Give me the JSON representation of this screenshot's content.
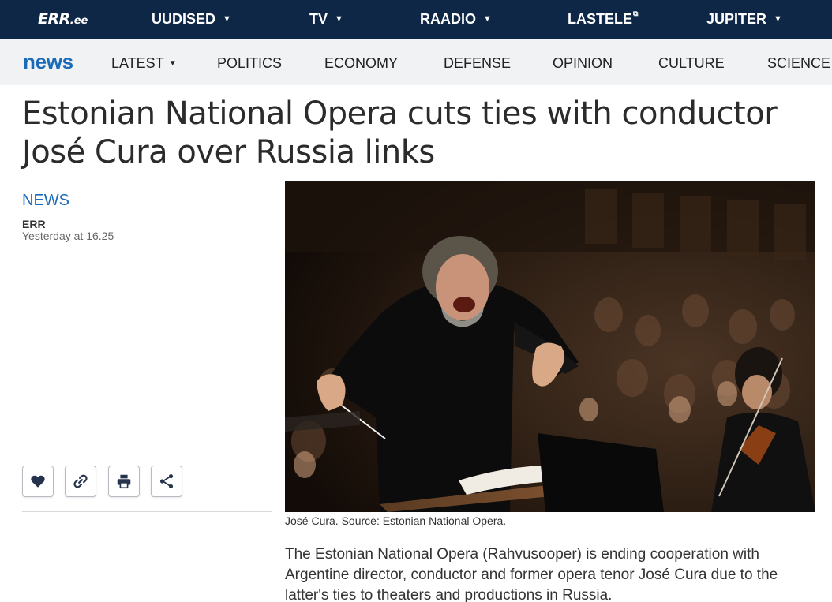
{
  "topbar": {
    "logo_main": "ERR",
    "logo_suffix": ".ee",
    "items": [
      {
        "label": "UUDISED",
        "has_dropdown": true
      },
      {
        "label": "TV",
        "has_dropdown": true
      },
      {
        "label": "RAADIO",
        "has_dropdown": true
      },
      {
        "label": "LASTELE",
        "external": true
      },
      {
        "label": "JUPITER",
        "has_dropdown": true
      }
    ]
  },
  "subnav": {
    "brand": "news",
    "items": [
      {
        "label": "LATEST",
        "has_dropdown": true
      },
      {
        "label": "POLITICS"
      },
      {
        "label": "ECONOMY"
      },
      {
        "label": "DEFENSE"
      },
      {
        "label": "OPINION"
      },
      {
        "label": "CULTURE"
      },
      {
        "label": "SCIENCE"
      }
    ]
  },
  "article": {
    "headline_line1": "Estonian National Opera cuts ties with conductor",
    "headline_line2": "José Cura over Russia links",
    "category": "NEWS",
    "author": "ERR",
    "date": "Yesterday at 16.25",
    "image_caption": "José Cura. Source: Estonian National Opera.",
    "lead": "The Estonian National Opera (Rahvusooper) is ending cooperation with Argentine director, conductor and former opera tenor José Cura due to the latter's ties to theaters and productions in Russia."
  },
  "actions": {
    "icons": [
      "heart-icon",
      "link-icon",
      "print-icon",
      "share-icon"
    ]
  },
  "colors": {
    "topbar_bg": "#0f2746",
    "subnav_bg": "#f1f2f3",
    "brand_blue": "#1a6bb8"
  }
}
